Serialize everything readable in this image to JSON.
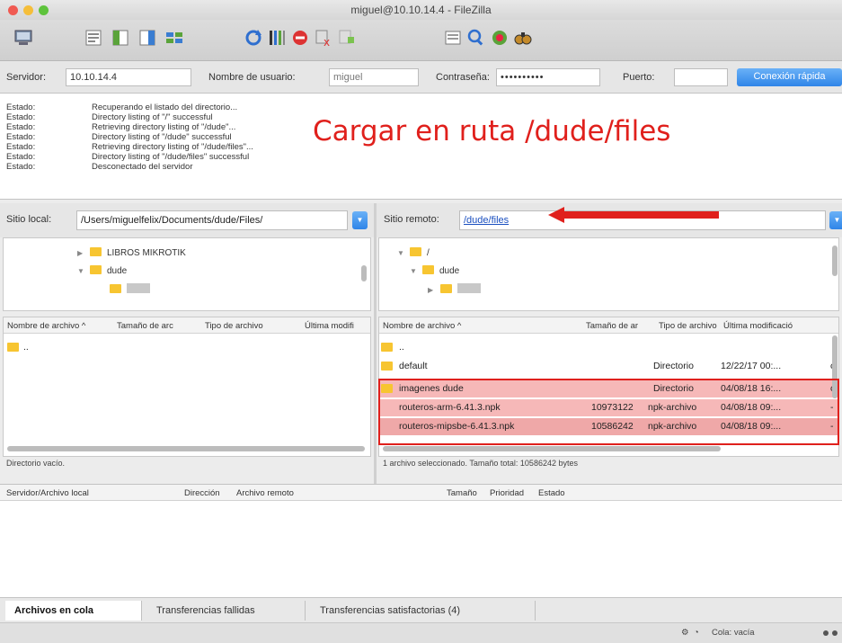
{
  "window": {
    "title": "miguel@10.10.14.4 - FileZilla"
  },
  "toolbar": {
    "icons": [
      "site-manager-icon",
      "toggle-log-icon",
      "toggle-local-tree-icon",
      "toggle-remote-tree-icon",
      "transfer-queue-icon",
      "refresh-icon",
      "process-queue-icon",
      "cancel-icon",
      "disconnect-icon",
      "reconnect-icon",
      "directory-compare-icon",
      "filter-icon",
      "sync-browse-icon",
      "search-icon"
    ]
  },
  "quickconnect": {
    "host_label": "Servidor:",
    "host_value": "10.10.14.4",
    "user_label": "Nombre de usuario:",
    "user_value": "miguel",
    "pass_label": "Contraseña:",
    "pass_value": "••••••••••",
    "port_label": "Puerto:",
    "port_value": "",
    "connect_label": "Conexión rápida"
  },
  "log": {
    "rows": [
      {
        "key": "Estado:",
        "msg": "Recuperando el listado del directorio..."
      },
      {
        "key": "Estado:",
        "msg": "Directory listing of \"/\" successful"
      },
      {
        "key": "Estado:",
        "msg": "Retrieving directory listing of \"/dude\"..."
      },
      {
        "key": "Estado:",
        "msg": "Directory listing of \"/dude\" successful"
      },
      {
        "key": "Estado:",
        "msg": "Retrieving directory listing of \"/dude/files\"..."
      },
      {
        "key": "Estado:",
        "msg": "Directory listing of \"/dude/files\" successful"
      },
      {
        "key": "Estado:",
        "msg": "Desconectado del servidor"
      }
    ]
  },
  "annotation": {
    "text": "Cargar en ruta /dude/files",
    "color": "#e0201c"
  },
  "local": {
    "site_label": "Sitio local:",
    "site_path": "/Users/miguelfelix/Documents/dude/Files/",
    "tree": [
      "LIBROS MIKROTIK",
      "dude"
    ],
    "headers": [
      "Nombre de archivo ^",
      "Tamaño de arc",
      "Tipo de archivo",
      "Última modifi"
    ],
    "files": [
      ".."
    ],
    "status": "Directorio vacío."
  },
  "remote": {
    "site_label": "Sitio remoto:",
    "site_path": "/dude/files",
    "tree": [
      "/",
      "dude"
    ],
    "headers": [
      "Nombre de archivo ^",
      "Tamaño de ar",
      "Tipo de archivo",
      "Última modificació"
    ],
    "files": [
      {
        "name": "..",
        "size": "",
        "type": "",
        "modified": "",
        "extra": ""
      },
      {
        "name": "default",
        "size": "",
        "type": "Directorio",
        "modified": "12/22/17 00:...",
        "extra": "c"
      },
      {
        "name": "imagenes dude",
        "size": "",
        "type": "Directorio",
        "modified": "04/08/18 16:...",
        "extra": "c"
      },
      {
        "name": "routeros-arm-6.41.3.npk",
        "size": "10973122",
        "type": "npk-archivo",
        "modified": "04/08/18 09:...",
        "extra": "-"
      },
      {
        "name": "routeros-mipsbe-6.41.3.npk",
        "size": "10586242",
        "type": "npk-archivo",
        "modified": "04/08/18 09:...",
        "extra": "-"
      }
    ],
    "status": "1 archivo seleccionado. Tamaño total: 10586242 bytes"
  },
  "queue": {
    "headers": [
      "Servidor/Archivo local",
      "Dirección",
      "Archivo remoto",
      "Tamaño",
      "Prioridad",
      "Estado"
    ]
  },
  "tabs": [
    "Archivos en cola",
    "Transferencias fallidas",
    "Transferencias satisfactorias (4)"
  ],
  "statusbar": {
    "queue_text": "Cola: vacía"
  },
  "colors": {
    "highlight": "#f6b8b8",
    "accent_blue": "#2f85e8",
    "annotation_red": "#e0201c"
  }
}
